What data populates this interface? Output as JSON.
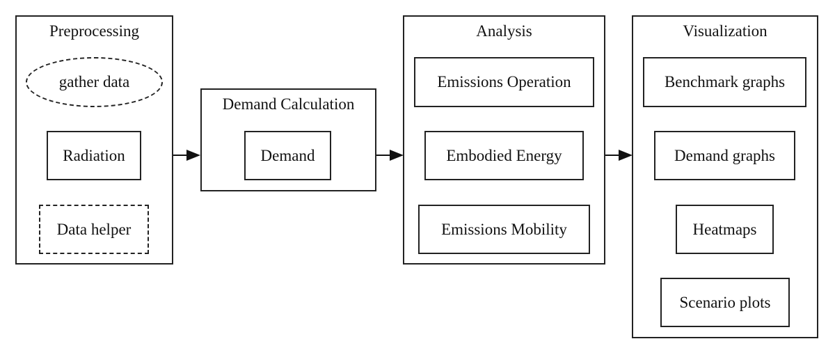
{
  "clusters": {
    "preprocessing": {
      "title": "Preprocessing",
      "nodes": [
        {
          "label": "gather data",
          "shape": "ellipse",
          "style": "dashed"
        },
        {
          "label": "Radiation",
          "shape": "box",
          "style": "solid"
        },
        {
          "label": "Data helper",
          "shape": "box",
          "style": "dashed"
        }
      ]
    },
    "demand_calculation": {
      "title": "Demand Calculation",
      "nodes": [
        {
          "label": "Demand",
          "shape": "box",
          "style": "solid"
        }
      ]
    },
    "analysis": {
      "title": "Analysis",
      "nodes": [
        {
          "label": "Emissions Operation",
          "shape": "box",
          "style": "solid"
        },
        {
          "label": "Embodied Energy",
          "shape": "box",
          "style": "solid"
        },
        {
          "label": "Emissions Mobility",
          "shape": "box",
          "style": "solid"
        }
      ]
    },
    "visualization": {
      "title": "Visualization",
      "nodes": [
        {
          "label": "Benchmark graphs",
          "shape": "box",
          "style": "solid"
        },
        {
          "label": "Demand graphs",
          "shape": "box",
          "style": "solid"
        },
        {
          "label": "Heatmaps",
          "shape": "box",
          "style": "solid"
        },
        {
          "label": "Scenario plots",
          "shape": "box",
          "style": "solid"
        }
      ]
    }
  },
  "edges": [
    {
      "from": "Preprocessing",
      "to": "Demand Calculation"
    },
    {
      "from": "Demand Calculation",
      "to": "Analysis"
    },
    {
      "from": "Analysis",
      "to": "Visualization"
    }
  ]
}
